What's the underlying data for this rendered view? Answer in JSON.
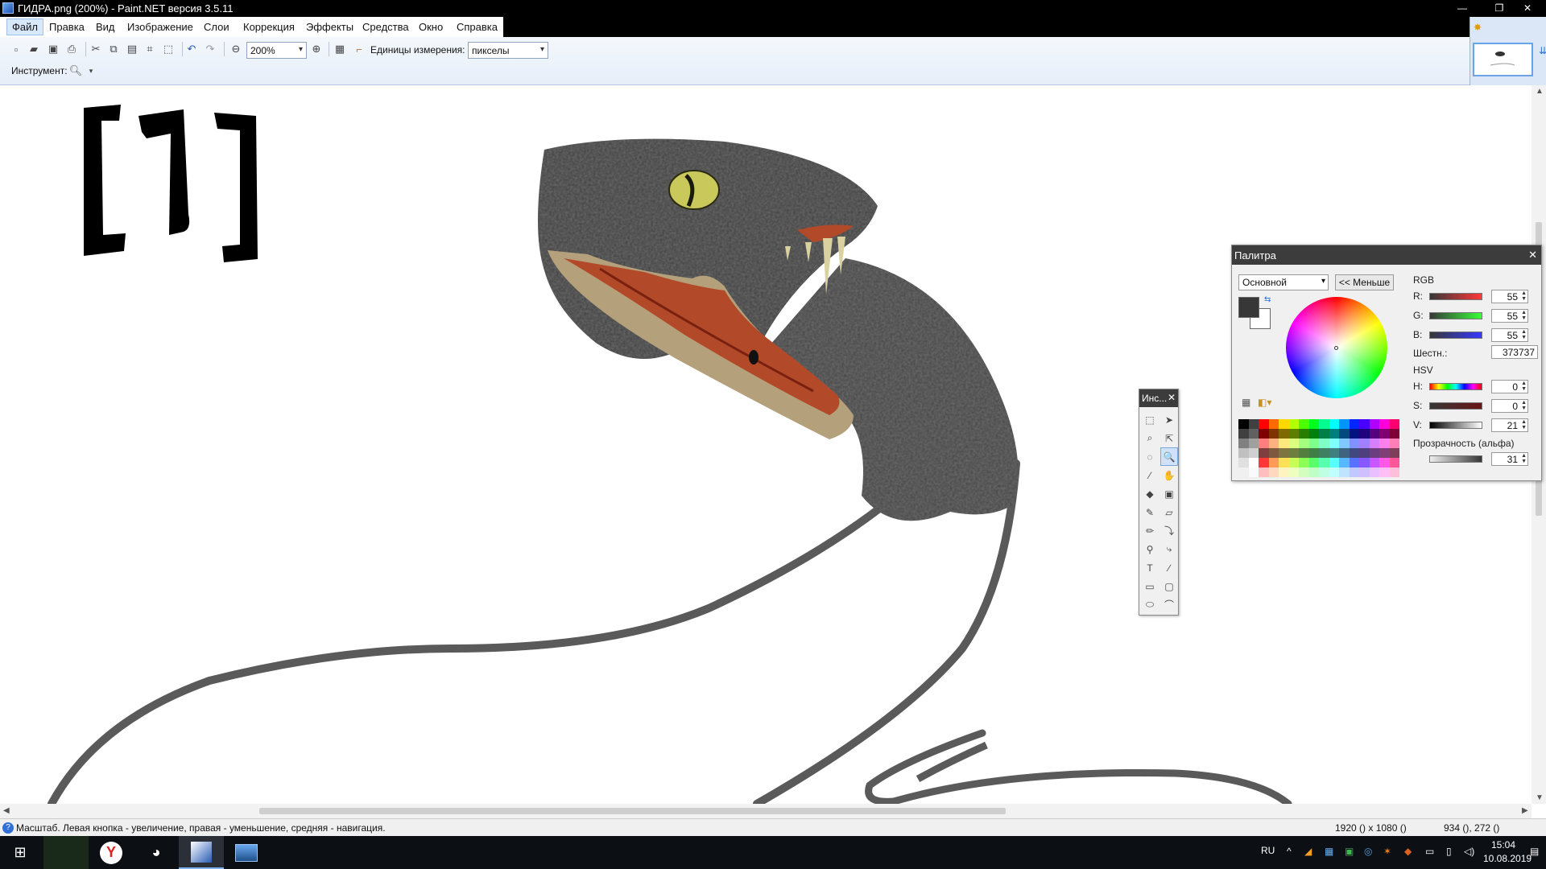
{
  "window": {
    "title": "ГИДРА.png (200%) - Paint.NET версия 3.5.11",
    "minimize_glyph": "—",
    "restore_glyph": "❐",
    "close_glyph": "✕"
  },
  "menu": [
    "Файл",
    "Правка",
    "Вид",
    "Изображение",
    "Слои",
    "Коррекция",
    "Эффекты",
    "Средства",
    "Окно",
    "Справка"
  ],
  "toolbar": {
    "zoom_value": "200%",
    "units_label": "Единицы измерения:",
    "units_value": "пикселы",
    "tool_label": "Инструмент:",
    "icons": [
      "new-icon",
      "open-icon",
      "save-icon",
      "print-icon",
      "cut-icon",
      "copy-icon",
      "paste-icon",
      "crop-icon",
      "deselect-icon",
      "undo-icon",
      "redo-icon",
      "zoom-out-icon",
      "zoom-in-icon",
      "grid-icon",
      "ruler-icon"
    ]
  },
  "canvas": {
    "caption": "[1]",
    "image_description_note": ""
  },
  "tools_window": {
    "title": "Инс...",
    "close": "✕",
    "tools": [
      {
        "name": "rectangle-select-tool",
        "glyph": "⬚",
        "selected": false
      },
      {
        "name": "move-selection-tool",
        "glyph": "➤",
        "selected": false
      },
      {
        "name": "lasso-select-tool",
        "glyph": "⌕",
        "selected": false
      },
      {
        "name": "move-selection-only-tool",
        "glyph": "⇱",
        "selected": false
      },
      {
        "name": "ellipse-select-tool",
        "glyph": "◌",
        "selected": false
      },
      {
        "name": "zoom-tool",
        "glyph": "🔍",
        "selected": true
      },
      {
        "name": "magic-wand-tool",
        "glyph": "⁄",
        "selected": false
      },
      {
        "name": "pan-tool",
        "glyph": "✋",
        "selected": false
      },
      {
        "name": "paint-bucket-tool",
        "glyph": "◆",
        "selected": false
      },
      {
        "name": "gradient-tool",
        "glyph": "▣",
        "selected": false
      },
      {
        "name": "paintbrush-tool",
        "glyph": "✎",
        "selected": false
      },
      {
        "name": "eraser-tool",
        "glyph": "▱",
        "selected": false
      },
      {
        "name": "pencil-tool",
        "glyph": "✏",
        "selected": false
      },
      {
        "name": "color-picker-tool",
        "glyph": "⤵",
        "selected": false
      },
      {
        "name": "clone-stamp-tool",
        "glyph": "⚲",
        "selected": false
      },
      {
        "name": "recolor-tool",
        "glyph": "⤷",
        "selected": false
      },
      {
        "name": "text-tool",
        "glyph": "T",
        "selected": false
      },
      {
        "name": "line-curve-tool",
        "glyph": "∕",
        "selected": false
      },
      {
        "name": "rectangle-tool",
        "glyph": "▭",
        "selected": false
      },
      {
        "name": "rounded-rectangle-tool",
        "glyph": "▢",
        "selected": false
      },
      {
        "name": "ellipse-tool",
        "glyph": "⬭",
        "selected": false
      },
      {
        "name": "freeform-shape-tool",
        "glyph": "⌒",
        "selected": false
      }
    ]
  },
  "palette_window": {
    "title": "Палитра",
    "close": "✕",
    "mode_select": "Основной",
    "less_button": "<< Меньше",
    "rgb_label": "RGB",
    "r_label": "R:",
    "r_value": "55",
    "g_label": "G:",
    "g_value": "55",
    "b_label": "B:",
    "b_value": "55",
    "hex_label": "Шестн.:",
    "hex_value": "373737",
    "hsv_label": "HSV",
    "h_label": "H:",
    "h_value": "0",
    "s_label": "S:",
    "s_value": "0",
    "v_label": "V:",
    "v_value": "21",
    "alpha_label": "Прозрачность (альфа)",
    "alpha_value": "31",
    "primary_color": "#373737",
    "secondary_color": "#ffffff"
  },
  "statusbar": {
    "text": "Масштаб. Левая кнопка - увеличение, правая - уменьшение, средняя - навигация.",
    "image_size": "1920 () x 1080 ()",
    "cursor_pos": "934 (), 272 ()"
  },
  "taskbar": {
    "language": "RU",
    "time": "15:04",
    "date": "10.08.2019"
  },
  "colors": {
    "accent": "#d7e8fb",
    "title_bg": "#000000",
    "taskbar_bg": "#0c0f14"
  }
}
